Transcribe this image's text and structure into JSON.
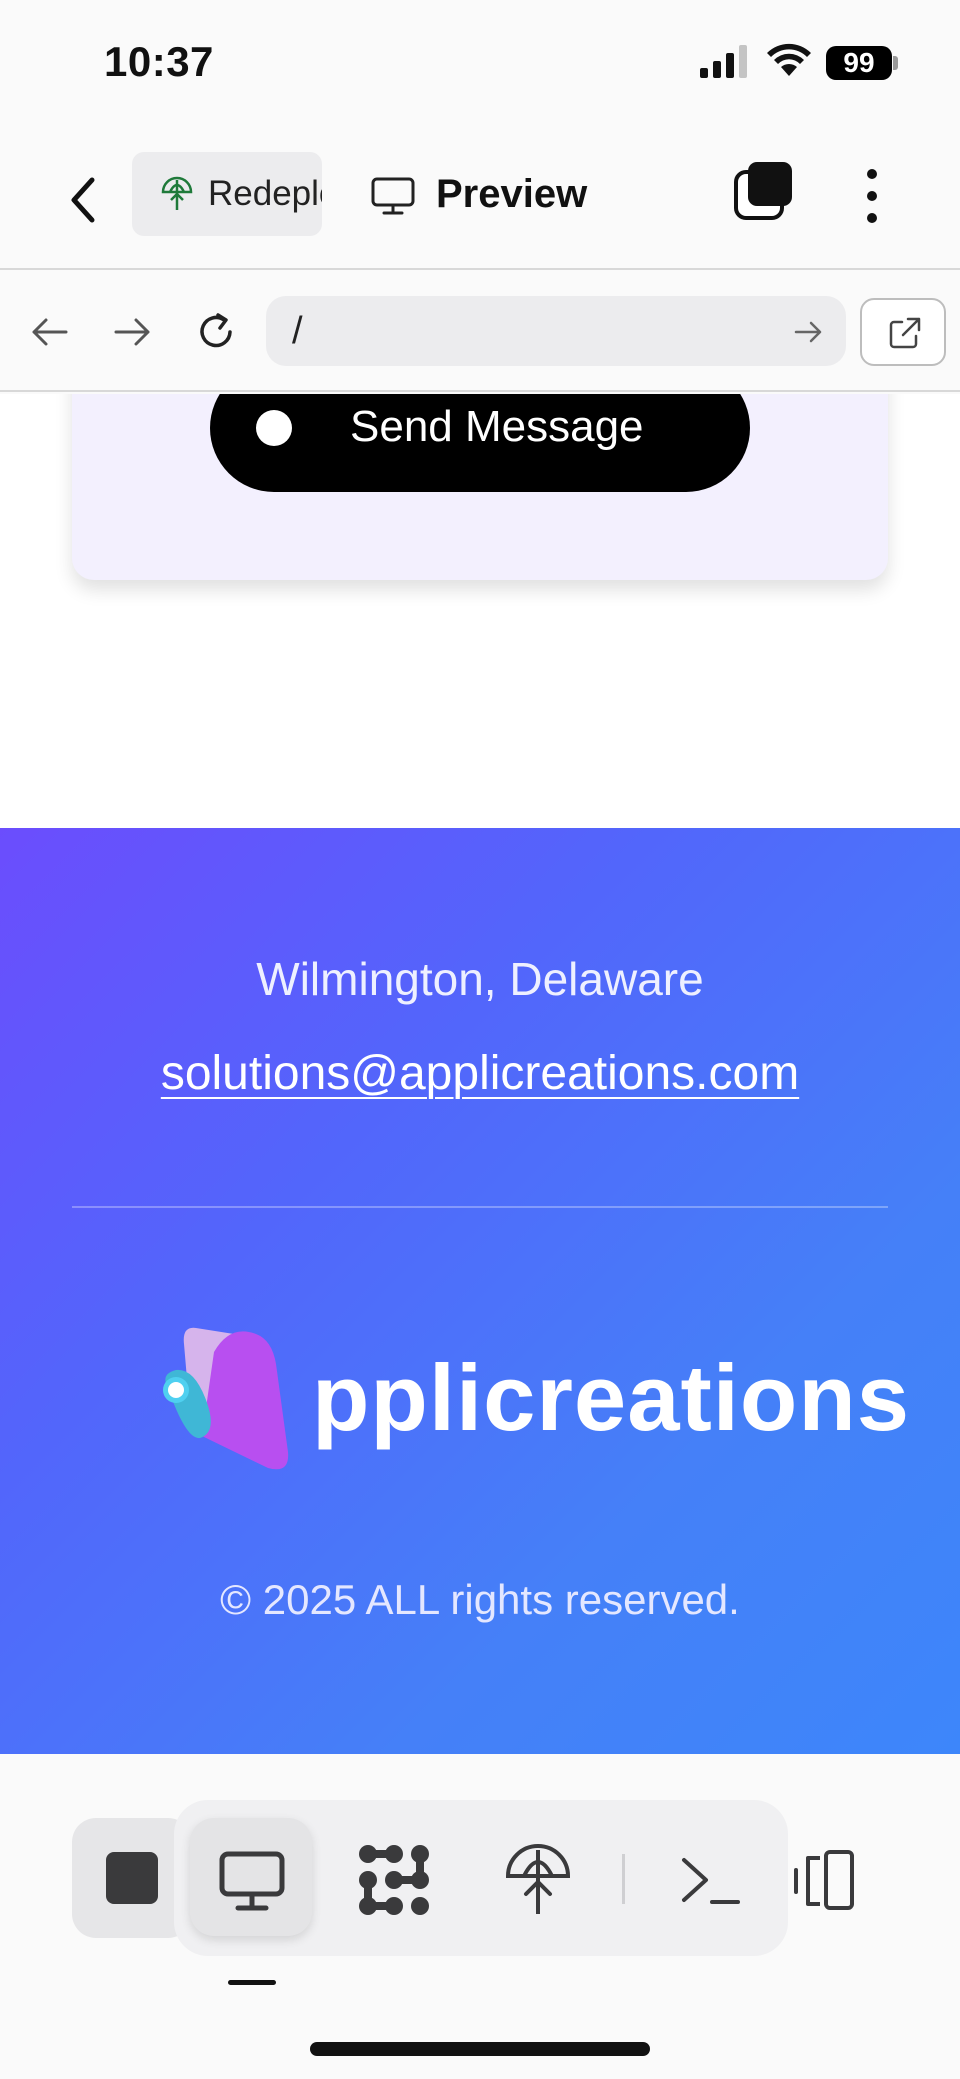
{
  "status_bar": {
    "time": "10:37",
    "battery": "99"
  },
  "header": {
    "tabs": [
      {
        "label": "Redeploy"
      },
      {
        "label": "Preview"
      }
    ]
  },
  "browser": {
    "url": "/"
  },
  "form": {
    "send_label": "Send Message"
  },
  "footer": {
    "location": "Wilmington, Delaware",
    "email": "solutions@applicreations.com",
    "logo_text": "pplicreations",
    "copyright": "© 2025 ALL rights reserved."
  },
  "colors": {
    "footer_gradient_start": "#6b4dfd",
    "footer_gradient_end": "#3d86fa",
    "card_bg": "#f3f0fe",
    "logo_magenta": "#b34fe8",
    "logo_cyan": "#3fb7d6"
  },
  "toolbar": {
    "icons": [
      "stop-icon",
      "monitor-icon",
      "apps-icon",
      "deploy-icon",
      "terminal-icon",
      "responsive-icon"
    ]
  }
}
